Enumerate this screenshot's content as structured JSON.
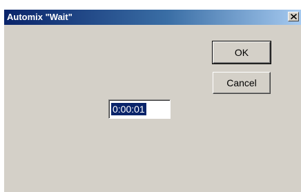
{
  "dialog": {
    "title": "Automix \"Wait\"",
    "close_icon": "close-x-icon"
  },
  "buttons": {
    "ok_label": "OK",
    "cancel_label": "Cancel"
  },
  "time_field": {
    "value": "0:00:01",
    "selected": true
  },
  "colors": {
    "window_bg": "#d4d0c8",
    "title_gradient_start": "#0a246a",
    "title_gradient_end": "#a6caf0",
    "selection_bg": "#0a246a"
  }
}
